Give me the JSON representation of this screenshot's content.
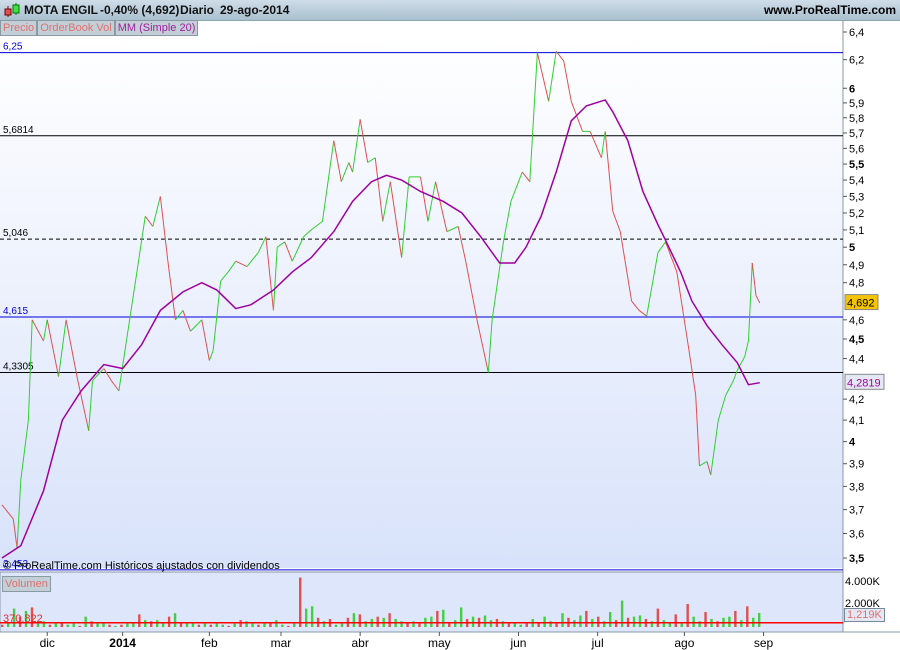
{
  "header": {
    "title": "MOTA ENGIL",
    "change": "-0,40% (4,692)",
    "period": "Diario",
    "date": "29-ago-2014",
    "site": "www.ProRealTime.com"
  },
  "tabs": [
    {
      "label": "Precio",
      "color": "#e07070"
    },
    {
      "label": "OrderBook Vol",
      "color": "#e07070"
    },
    {
      "label": "MM (Simple 20)",
      "color": "#a020a0"
    }
  ],
  "copyright": "© ProRealTime.com  Históricos ajustados con dividendos",
  "volume_panel": {
    "label": "Volumen",
    "avg_label": "370,822",
    "last_label": "1,219K",
    "ticks": [
      "4.000K",
      "2.000K"
    ]
  },
  "chart_data": {
    "type": "line",
    "scale": "log",
    "ylim": [
      3.45,
      6.45
    ],
    "yticks": [
      "6,4",
      "6,2",
      "6",
      "5,9",
      "5,8",
      "5,7",
      "5,6",
      "5,5",
      "5,4",
      "5,3",
      "5,2",
      "5,1",
      "5",
      "4,9",
      "4,8",
      "4,6",
      "4,5",
      "4,4",
      "4,2",
      "4,1",
      "4",
      "3,9",
      "3,8",
      "3,7",
      "3,6",
      "3,5"
    ],
    "ytick_values": [
      6.4,
      6.2,
      6,
      5.9,
      5.8,
      5.7,
      5.6,
      5.5,
      5.4,
      5.3,
      5.2,
      5.1,
      5,
      4.9,
      4.8,
      4.6,
      4.5,
      4.4,
      4.2,
      4.1,
      4,
      3.9,
      3.8,
      3.7,
      3.6,
      3.5
    ],
    "xticks": [
      {
        "label": "dic",
        "day": 12
      },
      {
        "label": "2014",
        "day": 32
      },
      {
        "label": "feb",
        "day": 55
      },
      {
        "label": "mar",
        "day": 74
      },
      {
        "label": "abr",
        "day": 95
      },
      {
        "label": "may",
        "day": 116
      },
      {
        "label": "jun",
        "day": 137
      },
      {
        "label": "jul",
        "day": 158
      },
      {
        "label": "ago",
        "day": 181
      },
      {
        "label": "sep",
        "day": 202
      }
    ],
    "price": {
      "name": "Precio",
      "last": "4,692",
      "points": [
        [
          0,
          3.72
        ],
        [
          1,
          3.7
        ],
        [
          3,
          3.66
        ],
        [
          4,
          3.54
        ],
        [
          5,
          3.83
        ],
        [
          7,
          4.1
        ],
        [
          8,
          4.6
        ],
        [
          11,
          4.49
        ],
        [
          12,
          4.6
        ],
        [
          15,
          4.31
        ],
        [
          17,
          4.6
        ],
        [
          20,
          4.3
        ],
        [
          23,
          4.05
        ],
        [
          24,
          4.29
        ],
        [
          27,
          4.35
        ],
        [
          29,
          4.29
        ],
        [
          31,
          4.24
        ],
        [
          33,
          4.49
        ],
        [
          36,
          4.89
        ],
        [
          38,
          5.18
        ],
        [
          40,
          5.12
        ],
        [
          42,
          5.3
        ],
        [
          44,
          4.92
        ],
        [
          46,
          4.6
        ],
        [
          48,
          4.65
        ],
        [
          50,
          4.54
        ],
        [
          53,
          4.6
        ],
        [
          55,
          4.39
        ],
        [
          56,
          4.44
        ],
        [
          58,
          4.81
        ],
        [
          60,
          4.86
        ],
        [
          62,
          4.92
        ],
        [
          65,
          4.89
        ],
        [
          68,
          4.97
        ],
        [
          70,
          5.06
        ],
        [
          72,
          4.65
        ],
        [
          73,
          5.0
        ],
        [
          75,
          5.03
        ],
        [
          77,
          4.92
        ],
        [
          80,
          5.06
        ],
        [
          82,
          5.1
        ],
        [
          85,
          5.15
        ],
        [
          88,
          5.65
        ],
        [
          90,
          5.39
        ],
        [
          92,
          5.51
        ],
        [
          93,
          5.45
        ],
        [
          95,
          5.79
        ],
        [
          97,
          5.51
        ],
        [
          99,
          5.54
        ],
        [
          101,
          5.15
        ],
        [
          103,
          5.39
        ],
        [
          106,
          4.94
        ],
        [
          108,
          5.42
        ],
        [
          111,
          5.42
        ],
        [
          113,
          5.15
        ],
        [
          115,
          5.39
        ],
        [
          118,
          5.09
        ],
        [
          121,
          5.12
        ],
        [
          123,
          4.92
        ],
        [
          126,
          4.6
        ],
        [
          129,
          4.33
        ],
        [
          130,
          4.6
        ],
        [
          133,
          5.03
        ],
        [
          135,
          5.27
        ],
        [
          138,
          5.45
        ],
        [
          140,
          5.39
        ],
        [
          142,
          6.25
        ],
        [
          145,
          5.91
        ],
        [
          147,
          6.26
        ],
        [
          149,
          6.19
        ],
        [
          151,
          5.91
        ],
        [
          154,
          5.71
        ],
        [
          156,
          5.71
        ],
        [
          159,
          5.54
        ],
        [
          160,
          5.71
        ],
        [
          162,
          5.21
        ],
        [
          164,
          5.09
        ],
        [
          167,
          4.7
        ],
        [
          169,
          4.65
        ],
        [
          171,
          4.62
        ],
        [
          174,
          4.97
        ],
        [
          176,
          5.03
        ],
        [
          179,
          4.86
        ],
        [
          182,
          4.47
        ],
        [
          184,
          4.22
        ],
        [
          185,
          3.89
        ],
        [
          187,
          3.91
        ],
        [
          188,
          3.85
        ],
        [
          190,
          4.1
        ],
        [
          192,
          4.22
        ],
        [
          194,
          4.29
        ],
        [
          195,
          4.34
        ],
        [
          197,
          4.41
        ],
        [
          198,
          4.49
        ],
        [
          199,
          4.91
        ],
        [
          200,
          4.73
        ],
        [
          201,
          4.69
        ]
      ]
    },
    "ma": {
      "name": "MM (Simple 20)",
      "last": "4,2819",
      "points": [
        [
          0,
          3.5
        ],
        [
          5,
          3.55
        ],
        [
          11,
          3.78
        ],
        [
          16,
          4.1
        ],
        [
          21,
          4.24
        ],
        [
          27,
          4.37
        ],
        [
          32,
          4.35
        ],
        [
          37,
          4.47
        ],
        [
          42,
          4.65
        ],
        [
          48,
          4.75
        ],
        [
          53,
          4.8
        ],
        [
          57,
          4.76
        ],
        [
          62,
          4.66
        ],
        [
          66,
          4.68
        ],
        [
          72,
          4.76
        ],
        [
          77,
          4.86
        ],
        [
          82,
          4.94
        ],
        [
          88,
          5.09
        ],
        [
          93,
          5.27
        ],
        [
          98,
          5.39
        ],
        [
          102,
          5.43
        ],
        [
          106,
          5.4
        ],
        [
          111,
          5.33
        ],
        [
          117,
          5.27
        ],
        [
          122,
          5.2
        ],
        [
          127,
          5.06
        ],
        [
          132,
          4.91
        ],
        [
          136,
          4.91
        ],
        [
          139,
          5.0
        ],
        [
          143,
          5.18
        ],
        [
          147,
          5.45
        ],
        [
          151,
          5.78
        ],
        [
          155,
          5.88
        ],
        [
          160,
          5.92
        ],
        [
          162,
          5.84
        ],
        [
          166,
          5.65
        ],
        [
          170,
          5.33
        ],
        [
          174,
          5.13
        ],
        [
          176,
          5.04
        ],
        [
          180,
          4.86
        ],
        [
          183,
          4.7
        ],
        [
          187,
          4.57
        ],
        [
          191,
          4.47
        ],
        [
          195,
          4.38
        ],
        [
          198,
          4.27
        ],
        [
          201,
          4.28
        ]
      ]
    },
    "hlines": [
      {
        "label": "6,25",
        "value": 6.25,
        "color": "#0000dd",
        "dash": false
      },
      {
        "label": "5,6814",
        "value": 5.6814,
        "color": "#000000",
        "dash": false
      },
      {
        "label": "5,046",
        "value": 5.046,
        "color": "#000000",
        "dash": true
      },
      {
        "label": "4,615",
        "value": 4.615,
        "color": "#0000dd",
        "dash": false
      },
      {
        "label": "4,3305",
        "value": 4.3305,
        "color": "#000000",
        "dash": false
      },
      {
        "label": "3,453",
        "value": 3.453,
        "color": "#0000dd",
        "dash": false
      }
    ],
    "volume": {
      "unit": "K",
      "avg": 370.822,
      "values": [
        200,
        400,
        1600,
        900,
        1400,
        1700,
        300,
        500,
        200,
        300,
        400,
        200,
        300,
        100,
        900,
        500,
        300,
        400,
        200,
        100,
        200,
        300,
        400,
        1100,
        600,
        500,
        600,
        400,
        900,
        1200,
        300,
        400,
        300,
        200,
        300,
        200,
        400,
        200,
        100,
        300,
        600,
        500,
        300,
        200,
        400,
        300,
        600,
        200,
        100,
        300,
        4300,
        1600,
        1800,
        800,
        500,
        700,
        200,
        400,
        800,
        1200,
        1100,
        500,
        700,
        900,
        800,
        1200,
        700,
        500,
        400,
        500,
        300,
        800,
        900,
        1400,
        1500,
        300,
        600,
        1700,
        700,
        900,
        800,
        1000,
        600,
        700,
        500,
        300,
        400,
        200,
        300,
        700,
        400,
        900,
        500,
        300,
        1200,
        800,
        600,
        1000,
        1400,
        700,
        900,
        500,
        1300,
        600,
        2300,
        800,
        900,
        1000,
        700,
        500,
        1600,
        600,
        400,
        1100,
        400,
        2000,
        900,
        500,
        1300,
        700,
        500,
        800,
        900,
        1400,
        600,
        1800,
        800,
        1219
      ]
    }
  }
}
